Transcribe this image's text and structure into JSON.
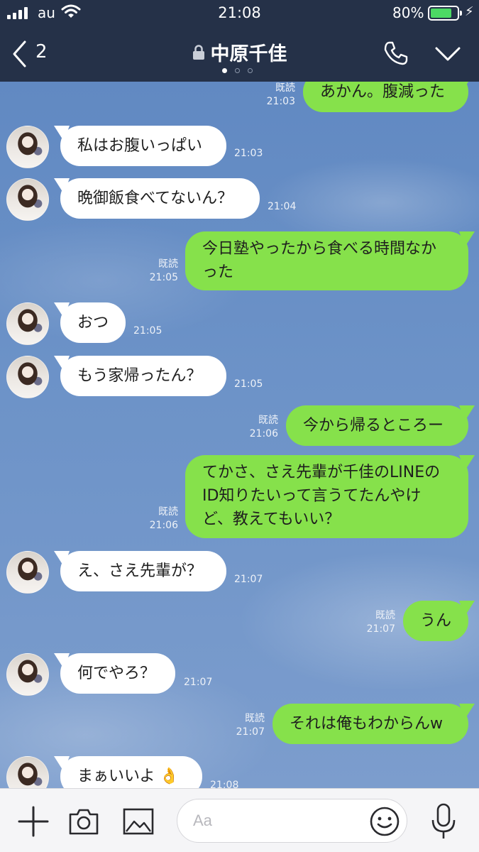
{
  "status_bar": {
    "carrier": "au",
    "time": "21:08",
    "battery_percent": "80%",
    "battery_level": 0.8
  },
  "header": {
    "back_count": "2",
    "title": "中原千佳",
    "page_dots": 3,
    "active_page": 0
  },
  "messages": [
    {
      "side": "out",
      "text": "あかん。腹減った",
      "read": "既読",
      "time": "21:03"
    },
    {
      "side": "in",
      "text": "私はお腹いっぱい",
      "time": "21:03"
    },
    {
      "side": "in",
      "text": "晩御飯食べてないん？",
      "time": "21:04"
    },
    {
      "side": "out",
      "text": "今日塾やったから食べる時間なかった",
      "read": "既読",
      "time": "21:05"
    },
    {
      "side": "in",
      "text": "おつ",
      "time": "21:05"
    },
    {
      "side": "in",
      "text": "もう家帰ったん？",
      "time": "21:05"
    },
    {
      "side": "out",
      "text": "今から帰るところー",
      "read": "既読",
      "time": "21:06"
    },
    {
      "side": "out",
      "text": "てかさ、さえ先輩が千佳のLINEのID知りたいって言うてたんやけど、教えてもいい？",
      "read": "既読",
      "time": "21:06"
    },
    {
      "side": "in",
      "text": "え、さえ先輩が？",
      "time": "21:07"
    },
    {
      "side": "out",
      "text": "うん",
      "read": "既読",
      "time": "21:07"
    },
    {
      "side": "in",
      "text": "何でやろ？",
      "time": "21:07"
    },
    {
      "side": "out",
      "text": "それは俺もわからんw",
      "read": "既読",
      "time": "21:07"
    },
    {
      "side": "in",
      "text": "まぁいいよ",
      "emoji": "👌",
      "time": "21:08"
    }
  ],
  "input_bar": {
    "placeholder": "Aa",
    "icons": [
      "plus-icon",
      "camera-icon",
      "image-icon",
      "smiley-icon",
      "microphone-icon"
    ]
  },
  "colors": {
    "header_bg": "#253148",
    "outgoing_bubble": "#86e14b",
    "incoming_bubble": "#ffffff",
    "battery_fill": "#4cd964"
  }
}
